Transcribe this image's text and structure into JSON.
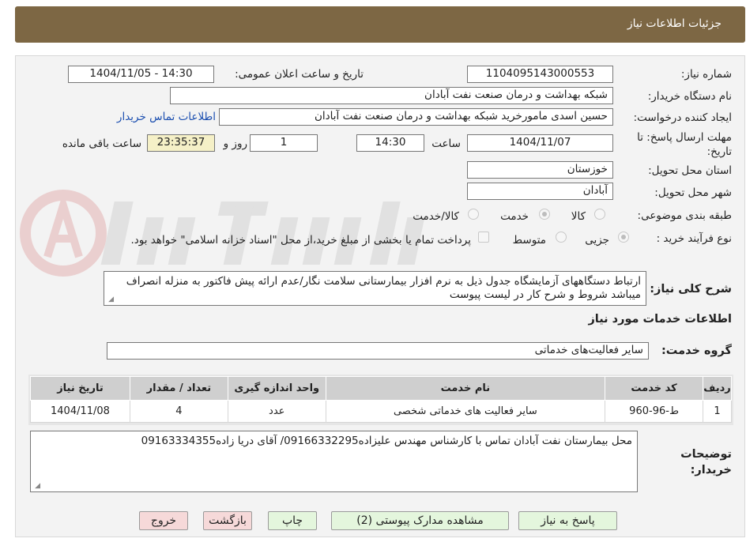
{
  "header": {
    "title": "جزئیات اطلاعات نیاز"
  },
  "form": {
    "need_number_label": "شماره نیاز:",
    "need_number": "1104095143000553",
    "announce_label": "تاریخ و ساعت اعلان عمومی:",
    "announce_value": "1404/11/05 - 14:30",
    "buyer_org_label": "نام دستگاه خریدار:",
    "buyer_org": "شبکه بهداشت و درمان صنعت نفت آبادان",
    "requester_label": "ایجاد کننده درخواست:",
    "requester": "حسین اسدی مامورخرید شبکه بهداشت و درمان صنعت نفت آبادان",
    "contact_link": "اطلاعات تماس خریدار",
    "deadline_label": "مهلت ارسال پاسخ: تا تاریخ:",
    "deadline_date": "1404/11/07",
    "time_label": "ساعت",
    "deadline_time": "14:30",
    "days_value": "1",
    "days_label": "روز و",
    "remaining_time": "23:35:37",
    "remaining_label": "ساعت باقی مانده",
    "province_label": "استان محل تحویل:",
    "province": "خوزستان",
    "city_label": "شهر محل تحویل:",
    "city": "آبادان",
    "category_label": "طبقه بندی موضوعی:",
    "category_options": [
      "کالا",
      "خدمت",
      "کالا/خدمت"
    ],
    "process_label": "نوع فرآیند خرید :",
    "process_options": [
      "جزیی",
      "متوسط"
    ],
    "payment_note": "پرداخت تمام یا بخشی از مبلغ خرید،از محل \"اسناد خزانه اسلامی\" خواهد بود."
  },
  "description": {
    "label": "شرح کلی نیاز:",
    "text": "ارتباط دستگاههای آزمایشگاه جدول ذیل به نرم افزار بیمارستانی سلامت نگار/عدم ارائه پیش فاکتور به منزله انصراف میباشد شروط و شرح کار در لیست پیوست"
  },
  "services": {
    "section_title": "اطلاعات خدمات مورد نیاز",
    "group_label": "گروه خدمت:",
    "group_value": "سایر فعالیت‌های خدماتی",
    "columns": [
      "ردیف",
      "کد خدمت",
      "نام خدمت",
      "واحد اندازه گیری",
      "تعداد / مقدار",
      "تاریخ نیاز"
    ],
    "rows": [
      [
        "1",
        "ط-96-960",
        "سایر فعالیت های خدماتی شخصی",
        "عدد",
        "4",
        "1404/11/08"
      ]
    ]
  },
  "buyer_notes": {
    "label": "توضیحات خریدار:",
    "text": "محل بیمارستان نفت آبادان تماس با کارشناس مهندس علیزاده09166332295/ آقای دریا زاده09163334355"
  },
  "buttons": {
    "reply": "پاسخ به نیاز",
    "attachments": "مشاهده مدارک پیوستی (2)",
    "print": "چاپ",
    "back": "بازگشت",
    "exit": "خروج"
  },
  "colors": {
    "header_bg": "#7d6744",
    "button_green": "#e4f6dd",
    "button_pink": "#f6d9d9"
  }
}
